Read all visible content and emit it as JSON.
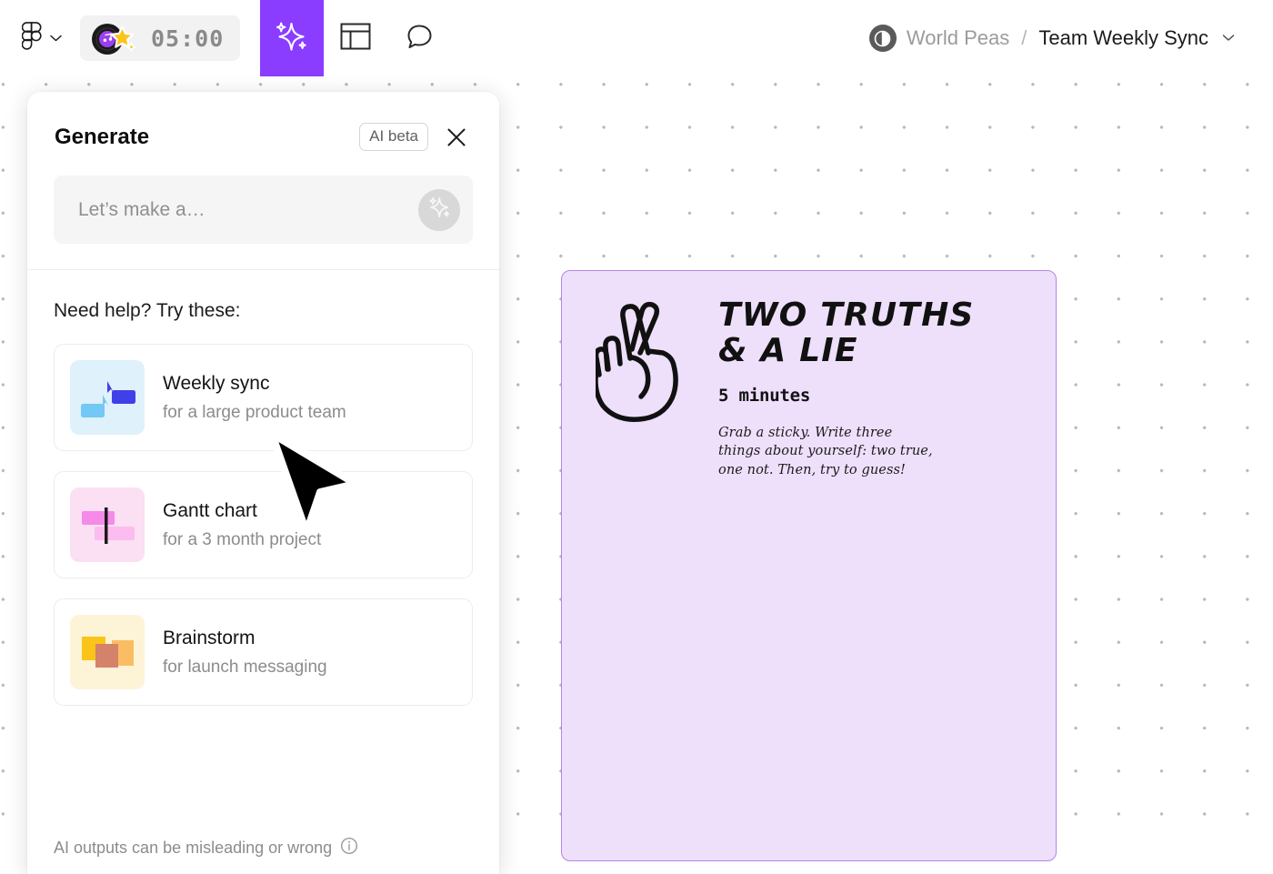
{
  "toolbar": {
    "logo_icon": "figma-logo-icon",
    "logo_caret_icon": "chevron-down-icon",
    "timer": {
      "value": "05:00",
      "record_icon": "vinyl-record-icon",
      "star_icon": "star-icon"
    },
    "tabs": [
      {
        "name": "ai-generate",
        "icon": "sparkle-icon",
        "active": true
      },
      {
        "name": "templates",
        "icon": "layout-grid-icon",
        "active": false
      },
      {
        "name": "comments",
        "icon": "comment-bubble-icon",
        "active": false
      }
    ]
  },
  "breadcrumb": {
    "avatar_icon": "team-avatar-icon",
    "team": "World Peas",
    "separator": "/",
    "file": "Team Weekly Sync",
    "caret_icon": "chevron-down-icon"
  },
  "panel": {
    "title": "Generate",
    "badge": "AI beta",
    "close_icon": "close-icon",
    "prompt": {
      "value": "",
      "placeholder": "Let’s make a…",
      "submit_icon": "sparkle-icon"
    },
    "help_label": "Need help? Try these:",
    "suggestions": [
      {
        "label": "Weekly sync",
        "sub": "for a large product team",
        "thumb": "weekly-sync-thumbnail",
        "thumb_bg": "#dff1fb"
      },
      {
        "label": "Gantt chart",
        "sub": "for a 3 month project",
        "thumb": "gantt-chart-thumbnail",
        "thumb_bg": "#fbdff3"
      },
      {
        "label": "Brainstorm",
        "sub": "for launch messaging",
        "thumb": "brainstorm-thumbnail",
        "thumb_bg": "#fdf3d6"
      }
    ],
    "footer_text": "AI outputs can be misleading or wrong",
    "footer_icon": "info-icon"
  },
  "canvas": {
    "card": {
      "title": "TWO TRUTHS\n& A LIE",
      "duration": "5 minutes",
      "description": "Grab a sticky. Write three\nthings about yourself: two true,\none not. Then, try to guess!",
      "illustration_icon": "crossed-fingers-hand-icon",
      "fill": "#eedffb",
      "border": "#b983e8"
    },
    "cursor_icon": "mouse-pointer-cursor"
  },
  "colors": {
    "accent_purple": "#8b3dff",
    "dot_grid": "#b9b9b9"
  }
}
